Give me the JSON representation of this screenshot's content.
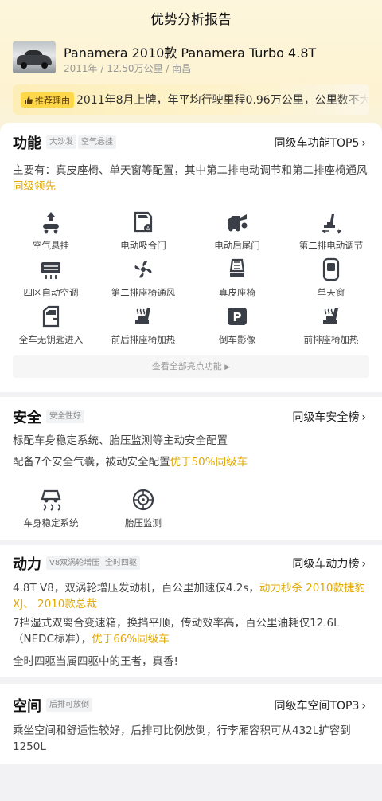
{
  "header": {
    "title": "优势分析报告"
  },
  "car": {
    "name": "Panamera 2010款 Panamera Turbo 4.8T",
    "meta": "2011年 / 12.50万公里 / 南昌"
  },
  "reason": {
    "badge": "推荐理由",
    "text": "2011年8月上牌，年平均行驶里程0.96万公里，公里数不大"
  },
  "function": {
    "title": "功能",
    "tags": [
      "大沙发",
      "空气悬挂"
    ],
    "link": "同级车功能TOP5",
    "desc": "主要有：真皮座椅、单天窗等配置，其中第二排电动调节和第二排座椅通风",
    "desc_highlight": "同级领先",
    "features": [
      {
        "icon": "air-suspension-icon",
        "label": "空气悬挂"
      },
      {
        "icon": "soft-close-door-icon",
        "label": "电动吸合门"
      },
      {
        "icon": "power-tailgate-icon",
        "label": "电动后尾门"
      },
      {
        "icon": "second-row-power-seat-icon",
        "label": "第二排电动调节"
      },
      {
        "icon": "four-zone-ac-icon",
        "label": "四区自动空调"
      },
      {
        "icon": "second-row-ventilation-icon",
        "label": "第二排座椅通风"
      },
      {
        "icon": "leather-seat-icon",
        "label": "真皮座椅"
      },
      {
        "icon": "sunroof-icon",
        "label": "单天窗"
      },
      {
        "icon": "keyless-entry-icon",
        "label": "全车无钥匙进入"
      },
      {
        "icon": "front-rear-seat-heating-icon",
        "label": "前后排座椅加热"
      },
      {
        "icon": "reverse-camera-icon",
        "label": "倒车影像"
      },
      {
        "icon": "front-seat-heating-icon",
        "label": "前排座椅加热"
      }
    ],
    "more": "查看全部亮点功能"
  },
  "safety": {
    "title": "安全",
    "tags": [
      "安全性好"
    ],
    "link": "同级车安全榜",
    "line1": "标配车身稳定系统、胎压监测等主动安全配置",
    "line2_prefix": "配备7个安全气囊，被动安全配置",
    "line2_highlight": "优于50%同级车",
    "features": [
      {
        "icon": "stability-control-icon",
        "label": "车身稳定系统"
      },
      {
        "icon": "tire-pressure-icon",
        "label": "胎压监测"
      }
    ]
  },
  "power": {
    "title": "动力",
    "tags": [
      "V8双涡轮增压",
      "全时四驱"
    ],
    "link": "同级车动力榜",
    "p1_prefix": "4.8T V8，双涡轮增压发动机，百公里加速仅4.2s，",
    "p1_highlight_a": "动力秒杀 2010款捷豹XJ",
    "p1_highlight_b": "、 2010款总裁",
    "p1_suffix": "◆",
    "p2_prefix": "7挡湿式双离合变速箱，换挡平顺，传动效率高，百公里油耗仅12.6L（NEDC标准），",
    "p2_highlight": "优于66%同级车",
    "p3": "全时四驱当属四驱中的王者，真香!"
  },
  "space": {
    "title": "空间",
    "tags": [
      "后排可放倒"
    ],
    "link": "同级车空间TOP3",
    "desc": "乘坐空间和舒适性较好，后排可比例放倒，行李厢容积可从432L扩容到1250L"
  },
  "colors": {
    "accent": "#e0a800",
    "badge": "#ffd84a"
  }
}
